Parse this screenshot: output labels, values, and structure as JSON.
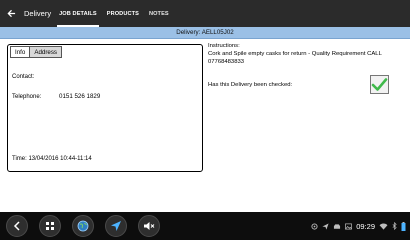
{
  "appbar": {
    "title": "Delivery",
    "tabs": [
      {
        "label": "JOB DETAILS",
        "active": true
      },
      {
        "label": "PRODUCTS",
        "active": false
      },
      {
        "label": "NOTES",
        "active": false
      }
    ]
  },
  "header": {
    "delivery": "Delivery: AELL05J02"
  },
  "panel": {
    "tabs": [
      "Info",
      "Address"
    ],
    "contact_label": "Contact:",
    "telephone_label": "Telephone:",
    "telephone_value": "0151 526 1829",
    "time": "Time: 13/04/2016 10:44-11:14"
  },
  "instructions": {
    "label": "Instructions:",
    "text": "Cork and Spile empty casks for return - Quality Requirement CALL 07768483833"
  },
  "checked": {
    "question": "Has this Delivery been checked:",
    "value": true
  },
  "statusbar": {
    "clock": "09:29"
  },
  "colors": {
    "appbar": "#2b2b2b",
    "subheader": "#9bc0e6",
    "check": "#3fb94a",
    "nav_accent": "#4db3ff"
  },
  "icons": {
    "back": "arrow-left-icon",
    "checkbox": "checkmark-icon",
    "nav": [
      "back-nav-icon",
      "apps-grid-icon",
      "globe-icon",
      "navigation-arrow-icon",
      "mute-icon"
    ],
    "status": [
      "location-icon",
      "send-icon",
      "car-icon",
      "photo-icon",
      "wifi-icon",
      "bluetooth-icon",
      "battery-icon"
    ]
  }
}
